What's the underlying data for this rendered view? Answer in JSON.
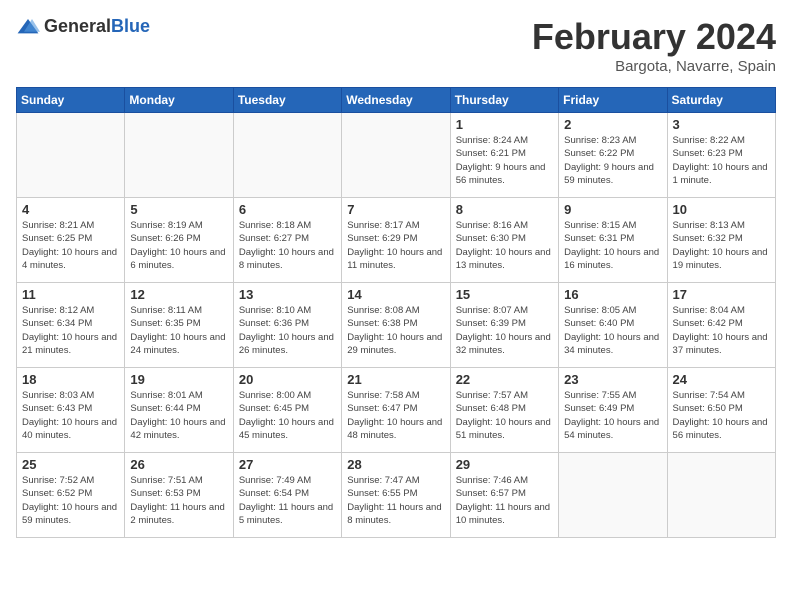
{
  "header": {
    "logo": {
      "general": "General",
      "blue": "Blue"
    },
    "title": "February 2024",
    "location": "Bargota, Navarre, Spain"
  },
  "weekdays": [
    "Sunday",
    "Monday",
    "Tuesday",
    "Wednesday",
    "Thursday",
    "Friday",
    "Saturday"
  ],
  "weeks": [
    [
      {
        "day": "",
        "info": ""
      },
      {
        "day": "",
        "info": ""
      },
      {
        "day": "",
        "info": ""
      },
      {
        "day": "",
        "info": ""
      },
      {
        "day": "1",
        "info": "Sunrise: 8:24 AM\nSunset: 6:21 PM\nDaylight: 9 hours and 56 minutes."
      },
      {
        "day": "2",
        "info": "Sunrise: 8:23 AM\nSunset: 6:22 PM\nDaylight: 9 hours and 59 minutes."
      },
      {
        "day": "3",
        "info": "Sunrise: 8:22 AM\nSunset: 6:23 PM\nDaylight: 10 hours and 1 minute."
      }
    ],
    [
      {
        "day": "4",
        "info": "Sunrise: 8:21 AM\nSunset: 6:25 PM\nDaylight: 10 hours and 4 minutes."
      },
      {
        "day": "5",
        "info": "Sunrise: 8:19 AM\nSunset: 6:26 PM\nDaylight: 10 hours and 6 minutes."
      },
      {
        "day": "6",
        "info": "Sunrise: 8:18 AM\nSunset: 6:27 PM\nDaylight: 10 hours and 8 minutes."
      },
      {
        "day": "7",
        "info": "Sunrise: 8:17 AM\nSunset: 6:29 PM\nDaylight: 10 hours and 11 minutes."
      },
      {
        "day": "8",
        "info": "Sunrise: 8:16 AM\nSunset: 6:30 PM\nDaylight: 10 hours and 13 minutes."
      },
      {
        "day": "9",
        "info": "Sunrise: 8:15 AM\nSunset: 6:31 PM\nDaylight: 10 hours and 16 minutes."
      },
      {
        "day": "10",
        "info": "Sunrise: 8:13 AM\nSunset: 6:32 PM\nDaylight: 10 hours and 19 minutes."
      }
    ],
    [
      {
        "day": "11",
        "info": "Sunrise: 8:12 AM\nSunset: 6:34 PM\nDaylight: 10 hours and 21 minutes."
      },
      {
        "day": "12",
        "info": "Sunrise: 8:11 AM\nSunset: 6:35 PM\nDaylight: 10 hours and 24 minutes."
      },
      {
        "day": "13",
        "info": "Sunrise: 8:10 AM\nSunset: 6:36 PM\nDaylight: 10 hours and 26 minutes."
      },
      {
        "day": "14",
        "info": "Sunrise: 8:08 AM\nSunset: 6:38 PM\nDaylight: 10 hours and 29 minutes."
      },
      {
        "day": "15",
        "info": "Sunrise: 8:07 AM\nSunset: 6:39 PM\nDaylight: 10 hours and 32 minutes."
      },
      {
        "day": "16",
        "info": "Sunrise: 8:05 AM\nSunset: 6:40 PM\nDaylight: 10 hours and 34 minutes."
      },
      {
        "day": "17",
        "info": "Sunrise: 8:04 AM\nSunset: 6:42 PM\nDaylight: 10 hours and 37 minutes."
      }
    ],
    [
      {
        "day": "18",
        "info": "Sunrise: 8:03 AM\nSunset: 6:43 PM\nDaylight: 10 hours and 40 minutes."
      },
      {
        "day": "19",
        "info": "Sunrise: 8:01 AM\nSunset: 6:44 PM\nDaylight: 10 hours and 42 minutes."
      },
      {
        "day": "20",
        "info": "Sunrise: 8:00 AM\nSunset: 6:45 PM\nDaylight: 10 hours and 45 minutes."
      },
      {
        "day": "21",
        "info": "Sunrise: 7:58 AM\nSunset: 6:47 PM\nDaylight: 10 hours and 48 minutes."
      },
      {
        "day": "22",
        "info": "Sunrise: 7:57 AM\nSunset: 6:48 PM\nDaylight: 10 hours and 51 minutes."
      },
      {
        "day": "23",
        "info": "Sunrise: 7:55 AM\nSunset: 6:49 PM\nDaylight: 10 hours and 54 minutes."
      },
      {
        "day": "24",
        "info": "Sunrise: 7:54 AM\nSunset: 6:50 PM\nDaylight: 10 hours and 56 minutes."
      }
    ],
    [
      {
        "day": "25",
        "info": "Sunrise: 7:52 AM\nSunset: 6:52 PM\nDaylight: 10 hours and 59 minutes."
      },
      {
        "day": "26",
        "info": "Sunrise: 7:51 AM\nSunset: 6:53 PM\nDaylight: 11 hours and 2 minutes."
      },
      {
        "day": "27",
        "info": "Sunrise: 7:49 AM\nSunset: 6:54 PM\nDaylight: 11 hours and 5 minutes."
      },
      {
        "day": "28",
        "info": "Sunrise: 7:47 AM\nSunset: 6:55 PM\nDaylight: 11 hours and 8 minutes."
      },
      {
        "day": "29",
        "info": "Sunrise: 7:46 AM\nSunset: 6:57 PM\nDaylight: 11 hours and 10 minutes."
      },
      {
        "day": "",
        "info": ""
      },
      {
        "day": "",
        "info": ""
      }
    ]
  ]
}
